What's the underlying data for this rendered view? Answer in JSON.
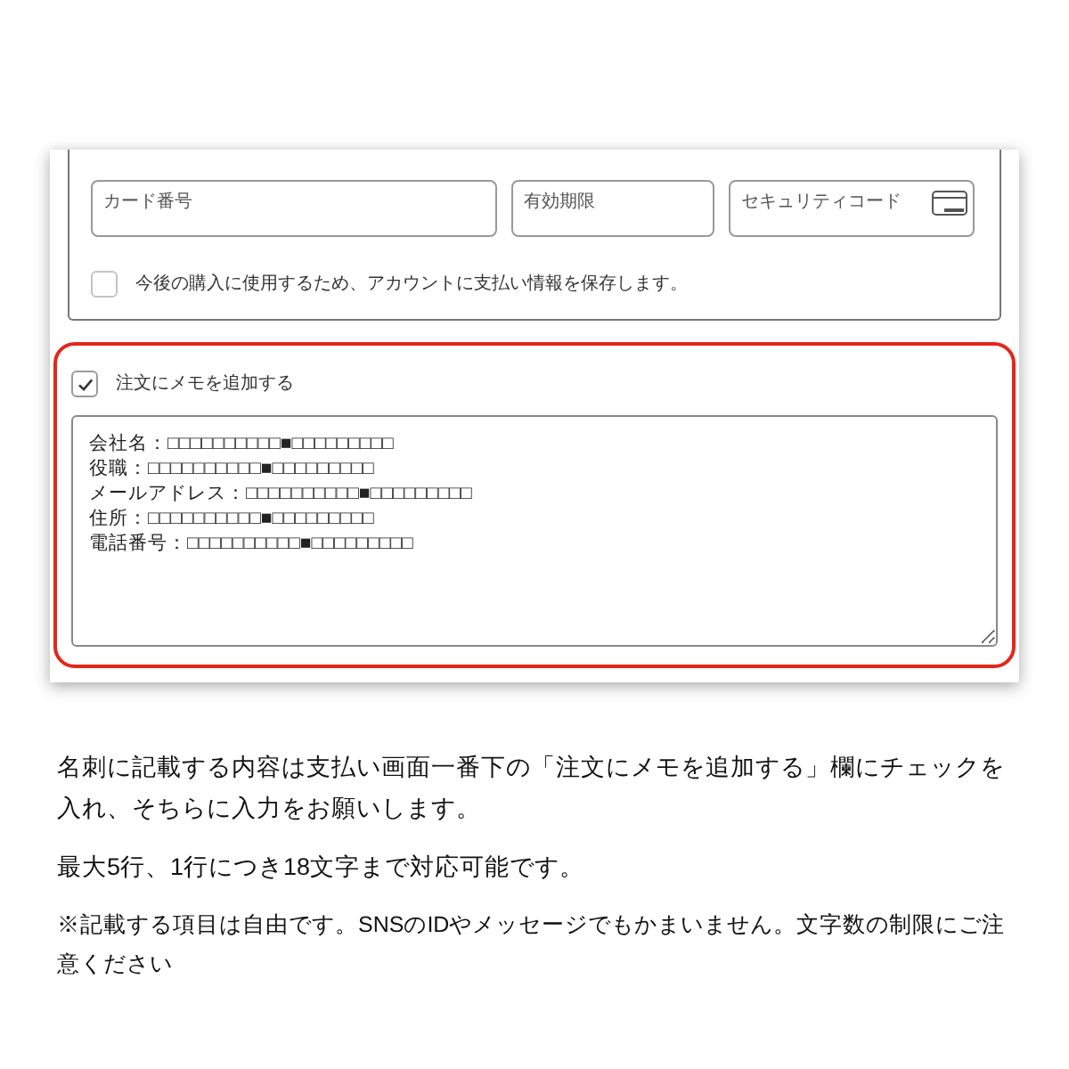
{
  "payment_form": {
    "fields": [
      {
        "placeholder": "カード番号"
      },
      {
        "placeholder": "有効期限"
      },
      {
        "placeholder": "セキュリティコード"
      }
    ],
    "save_info": {
      "label": "今後の購入に使用するため、アカウントに支払い情報を保存します。",
      "checked": false
    }
  },
  "memo": {
    "label": "注文にメモを追加する",
    "checked": true,
    "lines": [
      "会社名：□□□□□□□□□□■□□□□□□□□□",
      "役職：□□□□□□□□□□■□□□□□□□□□",
      "メールアドレス：□□□□□□□□□□■□□□□□□□□□",
      "住所：□□□□□□□□□□■□□□□□□□□□",
      "電話番号：□□□□□□□□□□■□□□□□□□□□"
    ]
  },
  "instructions": [
    "名刺に記載する内容は支払い画面一番下の「注文にメモを追加する」欄にチェックを入れ、そちらに入力をお願いします。",
    "最大5行、1行につき18文字まで対応可能です。"
  ],
  "note": "※記載する項目は自由です。SNSのIDやメッセージでもかまいません。文字数の制限にご注意ください"
}
